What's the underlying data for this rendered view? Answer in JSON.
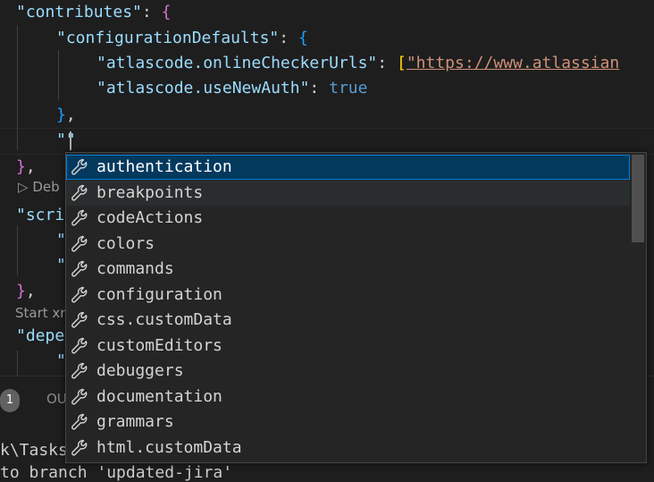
{
  "editor": {
    "lines": {
      "contributes_key": "\"contributes\"",
      "config_defaults_key": "\"configurationDefaults\"",
      "checker_key": "\"atlascode.onlineCheckerUrls\"",
      "checker_value": "\"https://www.atlassian",
      "newauth_key": "\"atlascode.useNewAuth\"",
      "newauth_value": "true",
      "typed_quotes": "\"\"",
      "scripts_key": "\"scri",
      "scripts_line2": "\"",
      "scripts_line3": "\"",
      "deps_key": "\"depe",
      "deps_line2": "\""
    },
    "codelens_debug": "Deb",
    "codelens_start": "Start xra",
    "colors": {
      "key": "#9cdcfe",
      "string": "#ce9178",
      "keyword": "#569cd6"
    }
  },
  "suggest": {
    "item_icon": "wrench-icon",
    "items": [
      "authentication",
      "breakpoints",
      "codeActions",
      "colors",
      "commands",
      "configuration",
      "css.customData",
      "customEditors",
      "debuggers",
      "documentation",
      "grammars",
      "html.customData"
    ],
    "selected_index": 0,
    "hover_index": 1,
    "colors": {
      "selected_bg": "#04395e",
      "selected_border": "#007fd4",
      "widget_bg": "#252526"
    }
  },
  "panel": {
    "problems_count": "1",
    "output_tab": "OU",
    "terminal_lines": [
      "k\\Tasks",
      "to branch 'updated-jira'"
    ]
  }
}
